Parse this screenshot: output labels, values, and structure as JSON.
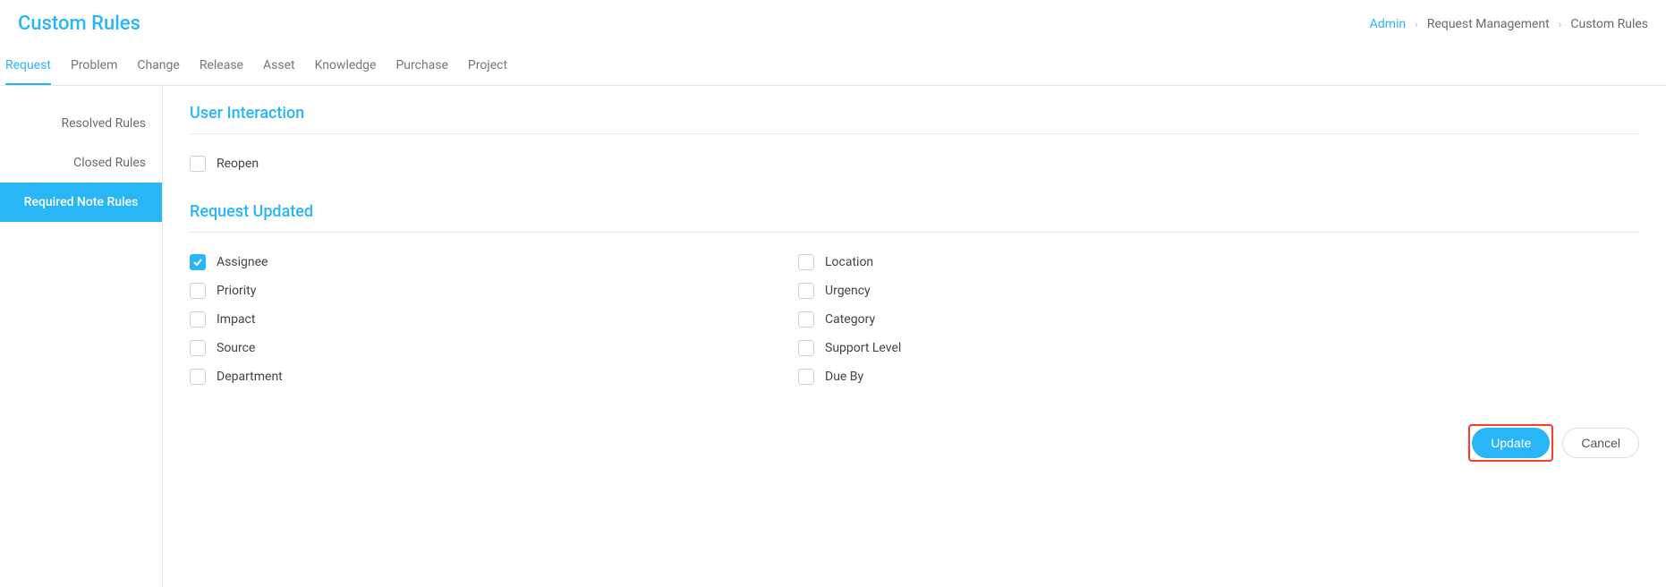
{
  "header": {
    "title": "Custom Rules"
  },
  "breadcrumb": {
    "admin": "Admin",
    "request_management": "Request Management",
    "custom_rules": "Custom Rules"
  },
  "tabs": [
    {
      "label": "Request",
      "active": true
    },
    {
      "label": "Problem",
      "active": false
    },
    {
      "label": "Change",
      "active": false
    },
    {
      "label": "Release",
      "active": false
    },
    {
      "label": "Asset",
      "active": false
    },
    {
      "label": "Knowledge",
      "active": false
    },
    {
      "label": "Purchase",
      "active": false
    },
    {
      "label": "Project",
      "active": false
    }
  ],
  "sidebar": {
    "items": [
      {
        "label": "Resolved Rules",
        "active": false
      },
      {
        "label": "Closed Rules",
        "active": false
      },
      {
        "label": "Required Note Rules",
        "active": true
      }
    ]
  },
  "sections": {
    "user_interaction": {
      "title": "User Interaction",
      "options": [
        {
          "label": "Reopen",
          "checked": false
        }
      ]
    },
    "request_updated": {
      "title": "Request Updated",
      "left": [
        {
          "label": "Assignee",
          "checked": true
        },
        {
          "label": "Priority",
          "checked": false
        },
        {
          "label": "Impact",
          "checked": false
        },
        {
          "label": "Source",
          "checked": false
        },
        {
          "label": "Department",
          "checked": false
        }
      ],
      "right": [
        {
          "label": "Location",
          "checked": false
        },
        {
          "label": "Urgency",
          "checked": false
        },
        {
          "label": "Category",
          "checked": false
        },
        {
          "label": "Support Level",
          "checked": false
        },
        {
          "label": "Due By",
          "checked": false
        }
      ]
    }
  },
  "actions": {
    "update": "Update",
    "cancel": "Cancel"
  }
}
